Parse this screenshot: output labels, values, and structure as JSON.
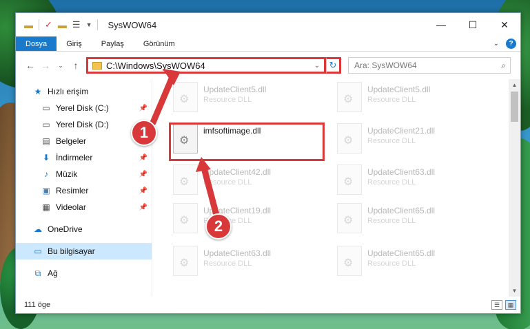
{
  "window": {
    "title": "SysWOW64"
  },
  "titlebar": {
    "minimize": "—",
    "maximize": "☐",
    "close": "✕"
  },
  "ribbon": {
    "tabs": [
      "Dosya",
      "Giriş",
      "Paylaş",
      "Görünüm"
    ],
    "help": "?"
  },
  "nav": {
    "address": "C:\\Windows\\SysWOW64",
    "search_placeholder": "Ara: SysWOW64"
  },
  "sidebar": {
    "quick_access": "Hızlı erişim",
    "items": [
      "Yerel Disk (C:)",
      "Yerel Disk (D:)",
      "Belgeler",
      "İndirmeler",
      "Müzik",
      "Resimler",
      "Videolar"
    ],
    "onedrive": "OneDrive",
    "this_pc": "Bu bilgisayar",
    "network": "Ağ"
  },
  "files": [
    {
      "name": "UpdateClient5.dll",
      "type": "Resource DLL"
    },
    {
      "name": "UpdateClient5.dll",
      "type": "Resource DLL"
    },
    {
      "name": "imfsoftimage.dll",
      "type": ""
    },
    {
      "name": "UpdateClient21.dll",
      "type": "Resource DLL"
    },
    {
      "name": "UpdateClient42.dll",
      "type": "Resource DLL"
    },
    {
      "name": "UpdateClient63.dll",
      "type": "Resource DLL"
    },
    {
      "name": "UpdateClient19.dll",
      "type": "Resource DLL"
    },
    {
      "name": "UpdateClient65.dll",
      "type": "Resource DLL"
    },
    {
      "name": "UpdateClient63.dll",
      "type": "Resource DLL"
    },
    {
      "name": "UpdateClient65.dll",
      "type": "Resource DLL"
    }
  ],
  "status": {
    "count": "111 öge"
  },
  "annotations": {
    "step1": "1",
    "step2": "2"
  },
  "colors": {
    "accent": "#1979ca",
    "highlight": "#d9383a"
  }
}
